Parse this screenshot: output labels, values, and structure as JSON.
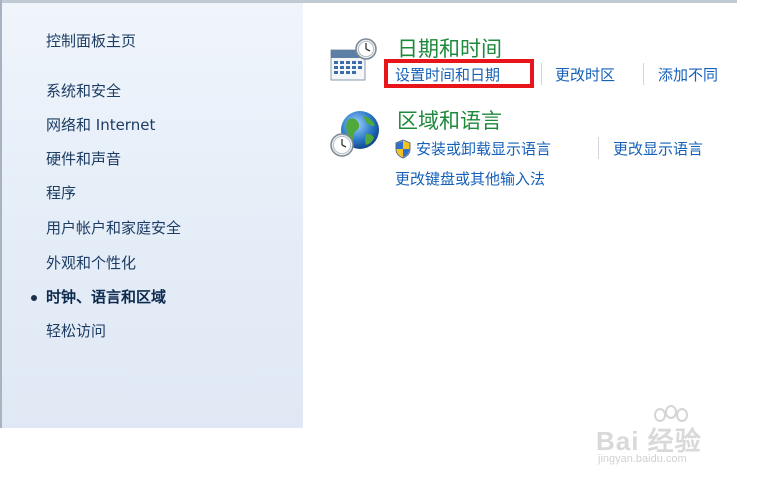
{
  "sidebar": {
    "home": "控制面板主页",
    "items": [
      "系统和安全",
      "网络和 Internet",
      "硬件和声音",
      "程序",
      "用户帐户和家庭安全",
      "外观和个性化",
      "时钟、语言和区域",
      "轻松访问"
    ],
    "selected_index": 6
  },
  "categories": [
    {
      "title": "日期和时间",
      "icon": "calendar-clock-icon",
      "links": [
        "设置时间和日期",
        "更改时区",
        "添加不同"
      ]
    },
    {
      "title": "区域和语言",
      "icon": "globe-clock-icon",
      "links": [
        "安装或卸载显示语言",
        "更改显示语言",
        "更改键盘或其他输入法"
      ],
      "shield_icon": "uac-shield-icon"
    }
  ],
  "annotation": {
    "highlight_color": "#e8151b",
    "highlighted_link": "设置时间和日期"
  },
  "watermark": {
    "main": "Bai 经验",
    "sub": "jingyan.baidu.com"
  },
  "colors": {
    "category_title": "#1e8a3c",
    "link": "#1560b8",
    "sidebar_text": "#1c3c63"
  }
}
